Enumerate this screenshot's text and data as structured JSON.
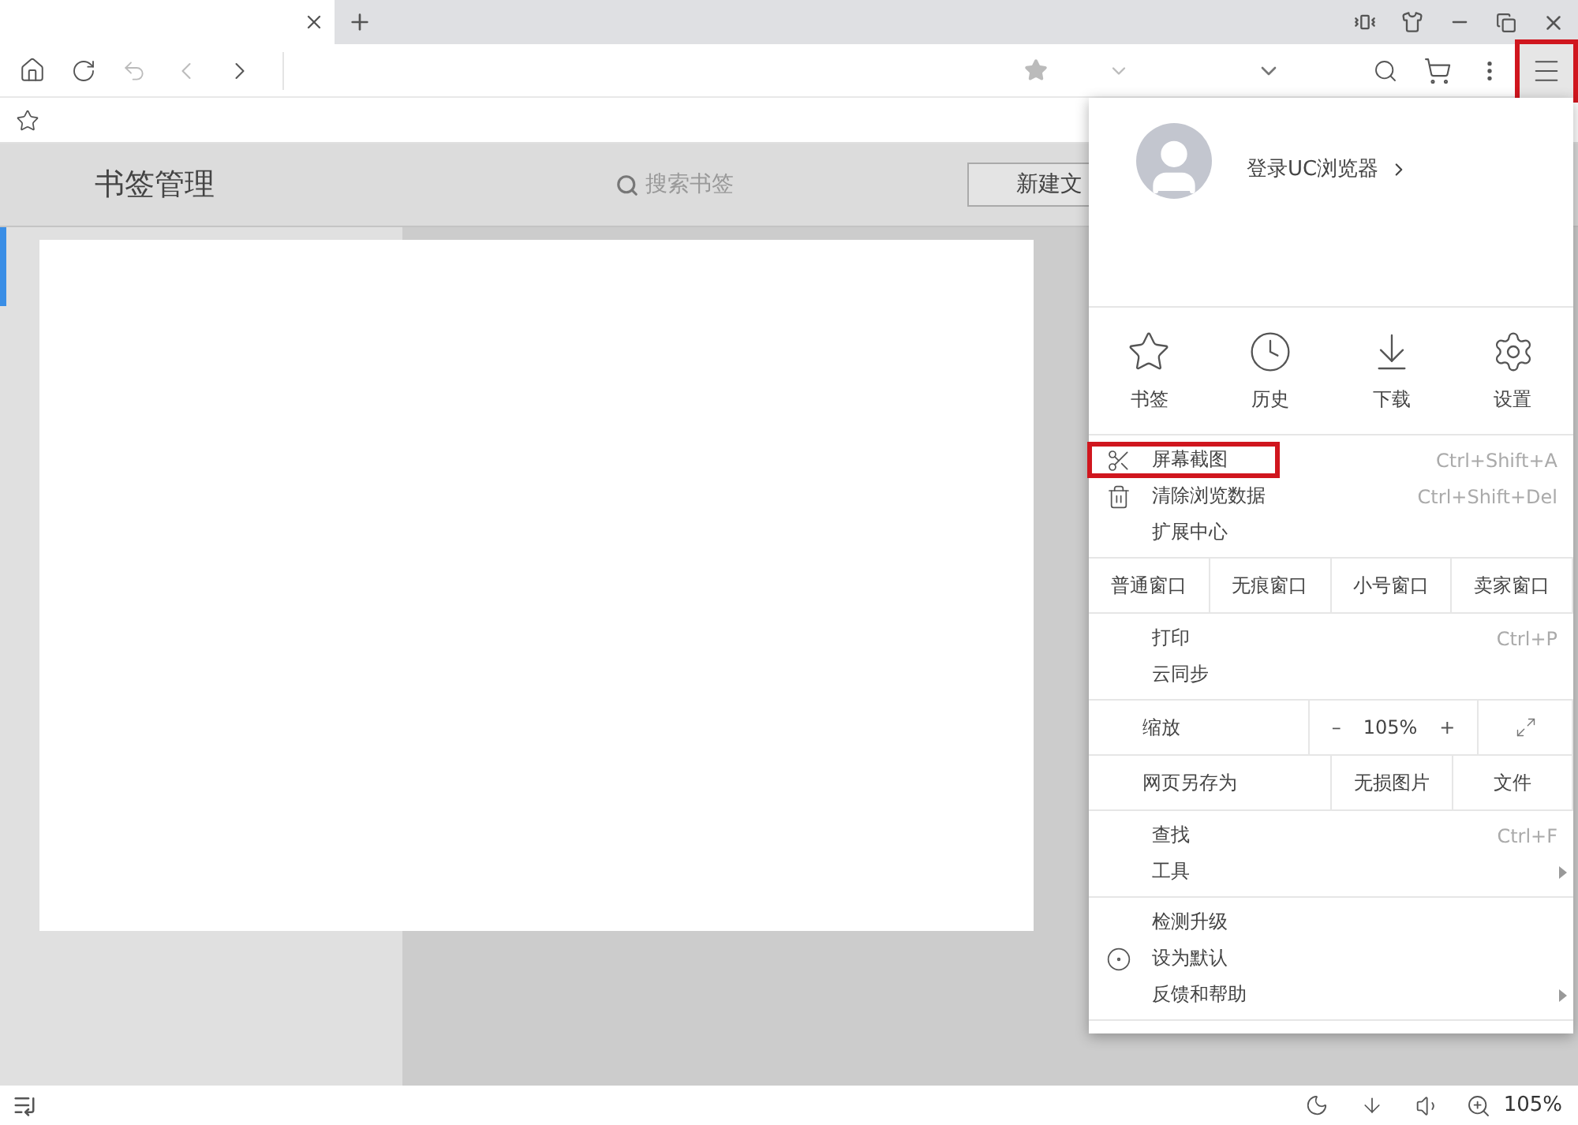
{
  "toolbar": {
    "menu_button": {
      "annotated": true
    }
  },
  "bookmark_manager": {
    "title": "书签管理",
    "search": {
      "placeholder": "搜索书签"
    },
    "new_button": "新建文"
  },
  "menu": {
    "login": "登录UC浏览器",
    "quick": [
      {
        "label": "书签",
        "kind": "star"
      },
      {
        "label": "历史",
        "kind": "clock"
      },
      {
        "label": "下载",
        "kind": "download"
      },
      {
        "label": "设置",
        "kind": "gear"
      }
    ],
    "tools": [
      {
        "label": "屏幕截图",
        "shortcut": "Ctrl+Shift+A",
        "kind": "scissors",
        "annotated": true
      },
      {
        "label": "清除浏览数据",
        "shortcut": "Ctrl+Shift+Del",
        "kind": "trash",
        "annotated": false
      },
      {
        "label": "扩展中心",
        "annotated": false
      }
    ],
    "windows": [
      "普通窗口",
      "无痕窗口",
      "小号窗口",
      "卖家窗口"
    ],
    "print": [
      {
        "label": "打印",
        "shortcut": "Ctrl+P",
        "submenu": false
      },
      {
        "label": "云同步",
        "submenu": false
      }
    ],
    "zoom": {
      "label": "缩放",
      "minus": "–",
      "value": "105%",
      "plus": "+"
    },
    "save": {
      "label": "网页另存为",
      "options": [
        "无损图片",
        "文件"
      ]
    },
    "find": [
      {
        "label": "查找",
        "shortcut": "Ctrl+F",
        "submenu": false
      },
      {
        "label": "工具",
        "submenu": true
      }
    ],
    "about": [
      {
        "label": "检测升级",
        "submenu": false
      },
      {
        "label": "设为默认",
        "kind": "radio",
        "submenu": false
      },
      {
        "label": "反馈和帮助",
        "submenu": true
      }
    ]
  },
  "status_bar": {
    "zoom": "105%"
  }
}
